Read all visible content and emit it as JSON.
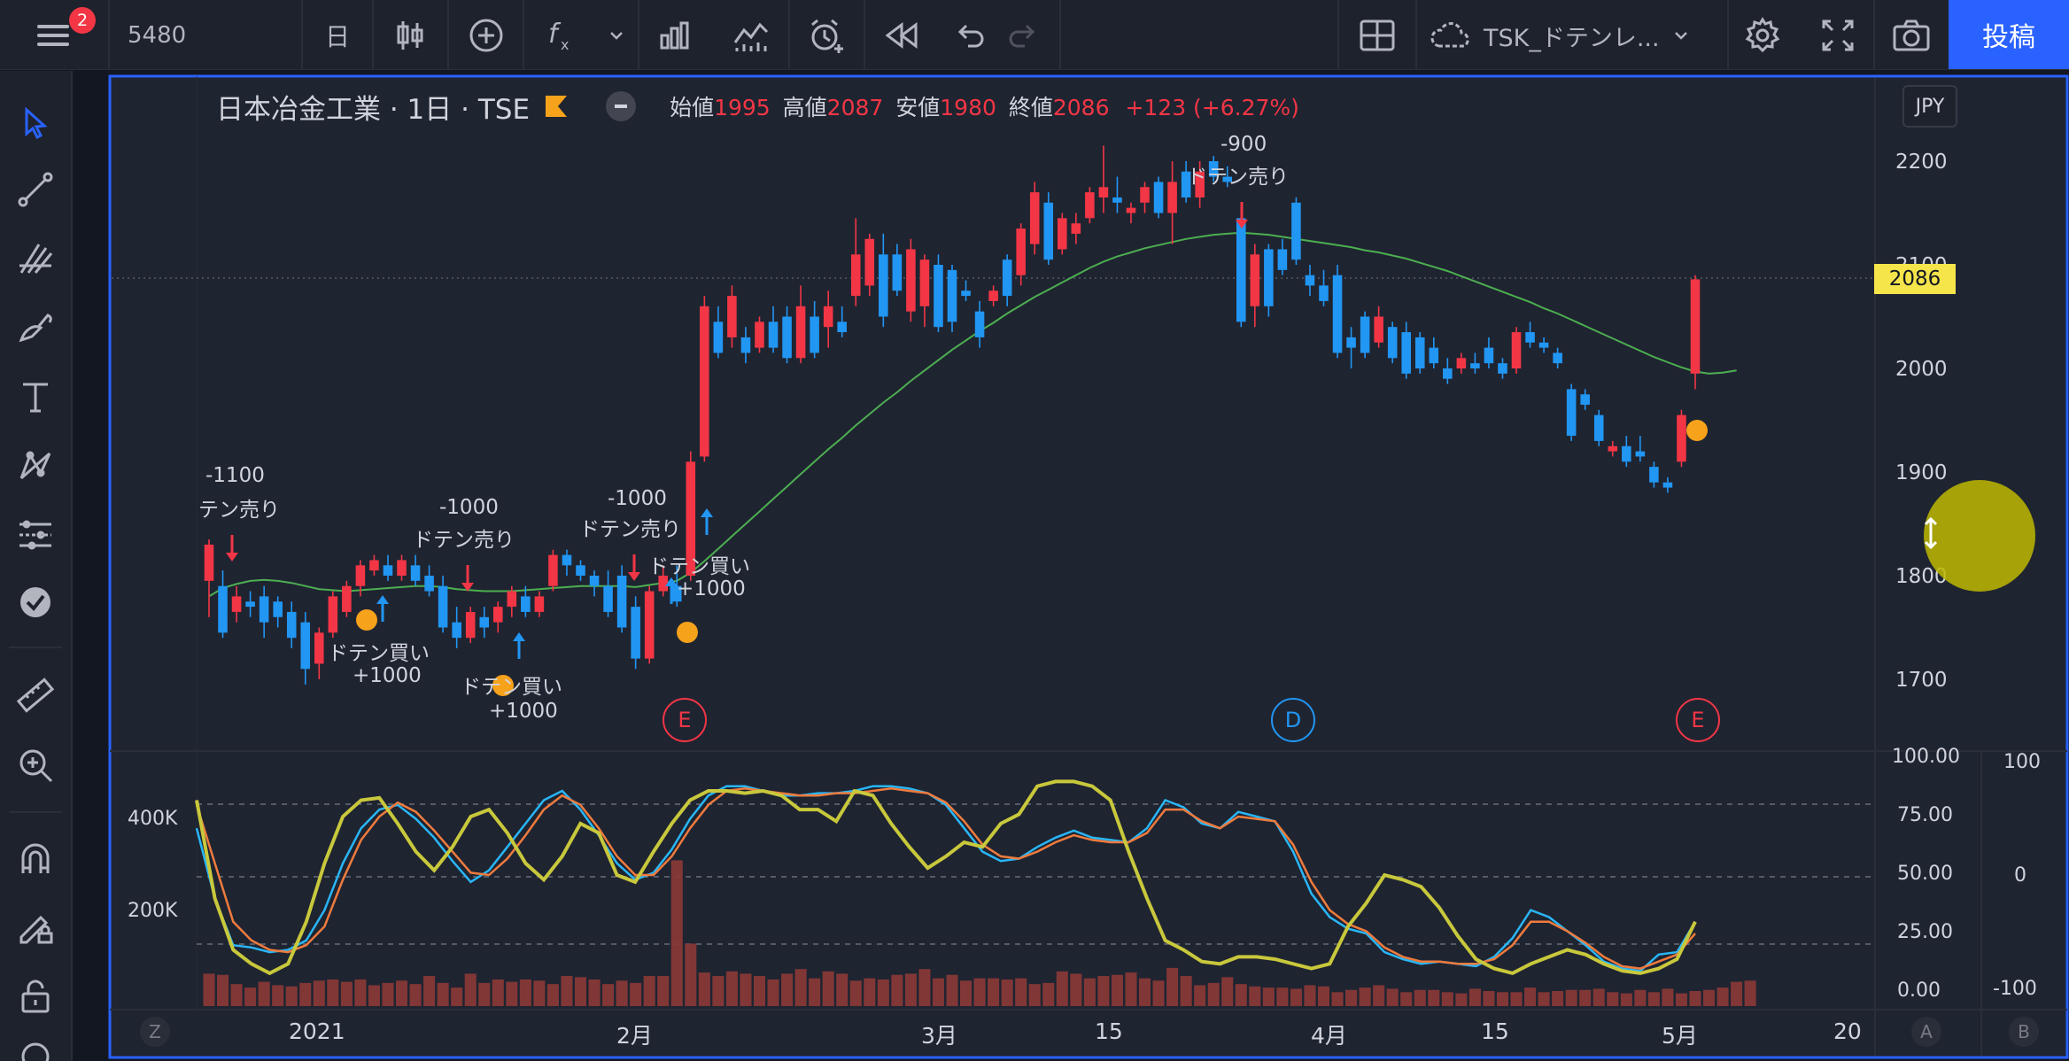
{
  "toolbar": {
    "menu_badge": "2",
    "symbol": "5480",
    "interval": "日",
    "indicator_label": "TSK_ドテンレ...",
    "publish_label": "投稿"
  },
  "legend": {
    "title": "日本冶金工業 · 1日 · TSE",
    "open_label": "始値",
    "open": "1995",
    "high_label": "高値",
    "high": "2087",
    "low_label": "安値",
    "low": "1980",
    "close_label": "終値",
    "close": "2086",
    "change": "+123 (+6.27%)"
  },
  "currency": "JPY",
  "last_price": "2086",
  "price_axis": {
    "ticks": [
      {
        "value": 2200,
        "label": "2200"
      },
      {
        "value": 2100,
        "label": "2100"
      },
      {
        "value": 2000,
        "label": "2000"
      },
      {
        "value": 1900,
        "label": "1900"
      },
      {
        "value": 1800,
        "label": "1800"
      },
      {
        "value": 1700,
        "label": "1700"
      }
    ]
  },
  "osc_axis": {
    "ticks": [
      "100.00",
      "75.00",
      "50.00",
      "25.00",
      "0.00"
    ],
    "right_ticks": [
      "100",
      "0",
      "-100"
    ],
    "volume_ticks": [
      "400K",
      "200K"
    ]
  },
  "time_axis": [
    "2021",
    "2月",
    "3月",
    "15",
    "4月",
    "15",
    "5月",
    "20"
  ],
  "bottom_buttons": {
    "left": "Z",
    "a": "A",
    "b": "B"
  },
  "event_markers": [
    "E",
    "D",
    "E"
  ],
  "signals": [
    {
      "text": "-1100"
    },
    {
      "text": "テン売り"
    },
    {
      "text": "-1000"
    },
    {
      "text": "ドテン売り"
    },
    {
      "text": "-1000"
    },
    {
      "text": "ドテン売り"
    },
    {
      "text": "-900"
    },
    {
      "text": "ドテン売り"
    },
    {
      "text": "ドテン買い"
    },
    {
      "text": "+1000"
    },
    {
      "text": "ドテン買い"
    },
    {
      "text": "+1000"
    },
    {
      "text": "ドテン買い"
    },
    {
      "text": "+1000"
    }
  ],
  "chart_data": {
    "type": "candlestick",
    "currency": "JPY",
    "ylim": [
      1660,
      2240
    ],
    "candles": [
      {
        "o": 1795,
        "h": 1835,
        "l": 1760,
        "c": 1830
      },
      {
        "o": 1790,
        "h": 1805,
        "l": 1740,
        "c": 1745
      },
      {
        "o": 1765,
        "h": 1790,
        "l": 1755,
        "c": 1780
      },
      {
        "o": 1775,
        "h": 1785,
        "l": 1760,
        "c": 1770
      },
      {
        "o": 1780,
        "h": 1790,
        "l": 1740,
        "c": 1755
      },
      {
        "o": 1775,
        "h": 1780,
        "l": 1750,
        "c": 1760
      },
      {
        "o": 1765,
        "h": 1775,
        "l": 1730,
        "c": 1740
      },
      {
        "o": 1755,
        "h": 1765,
        "l": 1695,
        "c": 1710
      },
      {
        "o": 1715,
        "h": 1750,
        "l": 1700,
        "c": 1745
      },
      {
        "o": 1745,
        "h": 1785,
        "l": 1740,
        "c": 1780
      },
      {
        "o": 1765,
        "h": 1795,
        "l": 1760,
        "c": 1790
      },
      {
        "o": 1790,
        "h": 1815,
        "l": 1780,
        "c": 1810
      },
      {
        "o": 1805,
        "h": 1820,
        "l": 1800,
        "c": 1815
      },
      {
        "o": 1810,
        "h": 1820,
        "l": 1795,
        "c": 1800
      },
      {
        "o": 1800,
        "h": 1820,
        "l": 1795,
        "c": 1815
      },
      {
        "o": 1810,
        "h": 1820,
        "l": 1790,
        "c": 1795
      },
      {
        "o": 1800,
        "h": 1810,
        "l": 1780,
        "c": 1785
      },
      {
        "o": 1790,
        "h": 1800,
        "l": 1745,
        "c": 1750
      },
      {
        "o": 1755,
        "h": 1770,
        "l": 1730,
        "c": 1740
      },
      {
        "o": 1740,
        "h": 1770,
        "l": 1735,
        "c": 1765
      },
      {
        "o": 1760,
        "h": 1770,
        "l": 1740,
        "c": 1750
      },
      {
        "o": 1755,
        "h": 1775,
        "l": 1745,
        "c": 1770
      },
      {
        "o": 1770,
        "h": 1790,
        "l": 1760,
        "c": 1785
      },
      {
        "o": 1780,
        "h": 1790,
        "l": 1760,
        "c": 1765
      },
      {
        "o": 1765,
        "h": 1785,
        "l": 1760,
        "c": 1780
      },
      {
        "o": 1790,
        "h": 1825,
        "l": 1785,
        "c": 1820
      },
      {
        "o": 1820,
        "h": 1825,
        "l": 1800,
        "c": 1810
      },
      {
        "o": 1810,
        "h": 1815,
        "l": 1795,
        "c": 1800
      },
      {
        "o": 1800,
        "h": 1805,
        "l": 1780,
        "c": 1790
      },
      {
        "o": 1790,
        "h": 1805,
        "l": 1760,
        "c": 1765
      },
      {
        "o": 1800,
        "h": 1810,
        "l": 1745,
        "c": 1750
      },
      {
        "o": 1770,
        "h": 1780,
        "l": 1710,
        "c": 1720
      },
      {
        "o": 1720,
        "h": 1790,
        "l": 1715,
        "c": 1785
      },
      {
        "o": 1785,
        "h": 1810,
        "l": 1780,
        "c": 1800
      },
      {
        "o": 1790,
        "h": 1810,
        "l": 1770,
        "c": 1775
      },
      {
        "o": 1800,
        "h": 1920,
        "l": 1795,
        "c": 1910
      },
      {
        "o": 1915,
        "h": 2070,
        "l": 1910,
        "c": 2060
      },
      {
        "o": 2045,
        "h": 2060,
        "l": 2010,
        "c": 2015
      },
      {
        "o": 2030,
        "h": 2080,
        "l": 2020,
        "c": 2070
      },
      {
        "o": 2030,
        "h": 2040,
        "l": 2005,
        "c": 2015
      },
      {
        "o": 2020,
        "h": 2050,
        "l": 2015,
        "c": 2045
      },
      {
        "o": 2045,
        "h": 2060,
        "l": 2015,
        "c": 2020
      },
      {
        "o": 2050,
        "h": 2060,
        "l": 2005,
        "c": 2010
      },
      {
        "o": 2010,
        "h": 2080,
        "l": 2005,
        "c": 2060
      },
      {
        "o": 2050,
        "h": 2065,
        "l": 2010,
        "c": 2015
      },
      {
        "o": 2040,
        "h": 2075,
        "l": 2020,
        "c": 2060
      },
      {
        "o": 2045,
        "h": 2060,
        "l": 2030,
        "c": 2035
      },
      {
        "o": 2070,
        "h": 2145,
        "l": 2060,
        "c": 2110
      },
      {
        "o": 2080,
        "h": 2130,
        "l": 2070,
        "c": 2125
      },
      {
        "o": 2110,
        "h": 2130,
        "l": 2040,
        "c": 2050
      },
      {
        "o": 2110,
        "h": 2120,
        "l": 2070,
        "c": 2075
      },
      {
        "o": 2055,
        "h": 2125,
        "l": 2045,
        "c": 2115
      },
      {
        "o": 2060,
        "h": 2110,
        "l": 2040,
        "c": 2105
      },
      {
        "o": 2100,
        "h": 2110,
        "l": 2035,
        "c": 2040
      },
      {
        "o": 2095,
        "h": 2100,
        "l": 2035,
        "c": 2045
      },
      {
        "o": 2075,
        "h": 2085,
        "l": 2065,
        "c": 2070
      },
      {
        "o": 2055,
        "h": 2065,
        "l": 2020,
        "c": 2030
      },
      {
        "o": 2065,
        "h": 2080,
        "l": 2060,
        "c": 2075
      },
      {
        "o": 2105,
        "h": 2110,
        "l": 2060,
        "c": 2070
      },
      {
        "o": 2090,
        "h": 2140,
        "l": 2080,
        "c": 2135
      },
      {
        "o": 2120,
        "h": 2180,
        "l": 2110,
        "c": 2170
      },
      {
        "o": 2160,
        "h": 2170,
        "l": 2100,
        "c": 2105
      },
      {
        "o": 2115,
        "h": 2150,
        "l": 2110,
        "c": 2145
      },
      {
        "o": 2130,
        "h": 2150,
        "l": 2120,
        "c": 2140
      },
      {
        "o": 2145,
        "h": 2175,
        "l": 2140,
        "c": 2170
      },
      {
        "o": 2165,
        "h": 2215,
        "l": 2150,
        "c": 2175
      },
      {
        "o": 2165,
        "h": 2185,
        "l": 2150,
        "c": 2160
      },
      {
        "o": 2150,
        "h": 2160,
        "l": 2140,
        "c": 2155
      },
      {
        "o": 2160,
        "h": 2180,
        "l": 2150,
        "c": 2175
      },
      {
        "o": 2180,
        "h": 2185,
        "l": 2145,
        "c": 2150
      },
      {
        "o": 2150,
        "h": 2200,
        "l": 2120,
        "c": 2180
      },
      {
        "o": 2190,
        "h": 2200,
        "l": 2160,
        "c": 2165
      },
      {
        "o": 2165,
        "h": 2200,
        "l": 2155,
        "c": 2190
      },
      {
        "o": 2200,
        "h": 2205,
        "l": 2180,
        "c": 2185
      },
      {
        "o": 2185,
        "h": 2195,
        "l": 2175,
        "c": 2180
      },
      {
        "o": 2145,
        "h": 2150,
        "l": 2040,
        "c": 2045
      },
      {
        "o": 2060,
        "h": 2120,
        "l": 2040,
        "c": 2110
      },
      {
        "o": 2115,
        "h": 2120,
        "l": 2050,
        "c": 2060
      },
      {
        "o": 2115,
        "h": 2125,
        "l": 2090,
        "c": 2095
      },
      {
        "o": 2160,
        "h": 2165,
        "l": 2100,
        "c": 2105
      },
      {
        "o": 2090,
        "h": 2100,
        "l": 2070,
        "c": 2080
      },
      {
        "o": 2080,
        "h": 2095,
        "l": 2060,
        "c": 2065
      },
      {
        "o": 2090,
        "h": 2100,
        "l": 2010,
        "c": 2015
      },
      {
        "o": 2030,
        "h": 2040,
        "l": 2000,
        "c": 2020
      },
      {
        "o": 2050,
        "h": 2055,
        "l": 2010,
        "c": 2015
      },
      {
        "o": 2025,
        "h": 2060,
        "l": 2020,
        "c": 2050
      },
      {
        "o": 2040,
        "h": 2045,
        "l": 2005,
        "c": 2010
      },
      {
        "o": 2035,
        "h": 2045,
        "l": 1990,
        "c": 1995
      },
      {
        "o": 2030,
        "h": 2035,
        "l": 1995,
        "c": 2000
      },
      {
        "o": 2020,
        "h": 2030,
        "l": 2000,
        "c": 2005
      },
      {
        "o": 2000,
        "h": 2010,
        "l": 1985,
        "c": 1990
      },
      {
        "o": 2000,
        "h": 2015,
        "l": 1995,
        "c": 2010
      },
      {
        "o": 2005,
        "h": 2015,
        "l": 1995,
        "c": 2000
      },
      {
        "o": 2020,
        "h": 2030,
        "l": 2000,
        "c": 2005
      },
      {
        "o": 2005,
        "h": 2010,
        "l": 1990,
        "c": 1995
      },
      {
        "o": 2000,
        "h": 2040,
        "l": 1995,
        "c": 2035
      },
      {
        "o": 2035,
        "h": 2045,
        "l": 2020,
        "c": 2025
      },
      {
        "o": 2025,
        "h": 2030,
        "l": 2015,
        "c": 2020
      },
      {
        "o": 2015,
        "h": 2020,
        "l": 2000,
        "c": 2005
      },
      {
        "o": 1980,
        "h": 1985,
        "l": 1930,
        "c": 1935
      },
      {
        "o": 1975,
        "h": 1980,
        "l": 1960,
        "c": 1965
      },
      {
        "o": 1955,
        "h": 1960,
        "l": 1925,
        "c": 1930
      },
      {
        "o": 1920,
        "h": 1930,
        "l": 1915,
        "c": 1925
      },
      {
        "o": 1925,
        "h": 1935,
        "l": 1905,
        "c": 1910
      },
      {
        "o": 1920,
        "h": 1935,
        "l": 1910,
        "c": 1915
      },
      {
        "o": 1905,
        "h": 1910,
        "l": 1885,
        "c": 1890
      },
      {
        "o": 1890,
        "h": 1895,
        "l": 1880,
        "c": 1885
      },
      {
        "o": 1910,
        "h": 1960,
        "l": 1905,
        "c": 1955
      },
      {
        "o": 1995,
        "h": 2090,
        "l": 1980,
        "c": 2086
      }
    ],
    "ma": [
      1780,
      1788,
      1792,
      1795,
      1796,
      1795,
      1793,
      1790,
      1787,
      1786,
      1785,
      1786,
      1787,
      1788,
      1789,
      1790,
      1790,
      1789,
      1787,
      1786,
      1785,
      1785,
      1785,
      1786,
      1787,
      1788,
      1789,
      1790,
      1790,
      1790,
      1790,
      1789,
      1791,
      1793,
      1795,
      1803,
      1814,
      1826,
      1838,
      1850,
      1862,
      1874,
      1886,
      1898,
      1910,
      1922,
      1933,
      1945,
      1956,
      1967,
      1977,
      1988,
      1998,
      2008,
      2018,
      2027,
      2036,
      2044,
      2053,
      2061,
      2069,
      2076,
      2083,
      2090,
      2097,
      2103,
      2108,
      2112,
      2116,
      2119,
      2122,
      2125,
      2127,
      2129,
      2130,
      2131,
      2130,
      2129,
      2127,
      2125,
      2123,
      2121,
      2119,
      2117,
      2114,
      2112,
      2109,
      2106,
      2102,
      2098,
      2094,
      2089,
      2084,
      2079,
      2074,
      2069,
      2064,
      2058,
      2053,
      2047,
      2041,
      2035,
      2029,
      2023,
      2017,
      2011,
      2006,
      2001,
      1997,
      1995,
      1996,
      1998
    ],
    "volume": [
      140,
      135,
      95,
      80,
      105,
      90,
      85,
      100,
      110,
      115,
      105,
      115,
      90,
      100,
      110,
      95,
      130,
      100,
      80,
      140,
      100,
      115,
      105,
      115,
      110,
      95,
      130,
      125,
      115,
      95,
      110,
      100,
      130,
      130,
      630,
      270,
      145,
      130,
      150,
      140,
      130,
      115,
      140,
      160,
      120,
      150,
      140,
      110,
      120,
      115,
      135,
      140,
      160,
      120,
      135,
      110,
      120,
      120,
      115,
      120,
      95,
      100,
      150,
      140,
      120,
      130,
      135,
      145,
      120,
      110,
      165,
      130,
      90,
      100,
      125,
      95,
      85,
      80,
      80,
      75,
      90,
      85,
      60,
      70,
      80,
      90,
      75,
      60,
      70,
      70,
      60,
      55,
      75,
      65,
      60,
      60,
      80,
      60,
      65,
      70,
      70,
      75,
      60,
      55,
      70,
      60,
      75,
      55,
      65,
      70,
      80,
      105,
      110
    ],
    "osc_series": [
      {
        "color": "#29b6f6",
        "values": [
          70,
          40,
          20,
          19,
          17,
          18,
          22,
          35,
          55,
          70,
          78,
          80,
          74,
          66,
          56,
          47,
          52,
          62,
          72,
          82,
          86,
          78,
          67,
          55,
          48,
          51,
          61,
          74,
          84,
          88,
          88,
          86,
          84,
          84,
          85,
          85,
          86,
          88,
          88,
          87,
          85,
          80,
          70,
          60,
          56,
          57,
          62,
          66,
          69,
          66,
          65,
          64,
          70,
          82,
          79,
          72,
          70,
          77,
          75,
          73,
          60,
          42,
          32,
          27,
          25,
          17,
          14,
          12,
          13,
          12,
          11,
          15,
          23,
          35,
          32,
          26,
          20,
          13,
          10,
          9,
          16,
          17,
          30
        ]
      },
      {
        "color": "#ef7b3d",
        "values": [
          80,
          55,
          30,
          22,
          18,
          17,
          20,
          28,
          48,
          65,
          75,
          81,
          77,
          69,
          60,
          51,
          50,
          57,
          67,
          78,
          84,
          80,
          70,
          58,
          50,
          50,
          58,
          70,
          80,
          86,
          87,
          86,
          85,
          84,
          84,
          85,
          85,
          86,
          87,
          86,
          85,
          81,
          73,
          63,
          58,
          57,
          60,
          64,
          67,
          65,
          64,
          64,
          68,
          78,
          78,
          73,
          70,
          75,
          74,
          73,
          63,
          47,
          35,
          29,
          26,
          19,
          15,
          13,
          13,
          12,
          12,
          14,
          20,
          30,
          30,
          26,
          21,
          15,
          11,
          10,
          13,
          16,
          25
        ]
      },
      {
        "color": "#c8c83c",
        "values": [
          82,
          40,
          18,
          12,
          8,
          12,
          30,
          55,
          75,
          82,
          83,
          72,
          60,
          52,
          62,
          75,
          78,
          68,
          55,
          48,
          58,
          72,
          68,
          50,
          47,
          60,
          72,
          82,
          86,
          86,
          85,
          86,
          84,
          78,
          78,
          73,
          86,
          84,
          72,
          62,
          53,
          58,
          64,
          62,
          72,
          76,
          88,
          90,
          90,
          88,
          82,
          60,
          40,
          22,
          18,
          13,
          12,
          15,
          15,
          14,
          12,
          10,
          12,
          28,
          38,
          50,
          48,
          45,
          36,
          24,
          14,
          10,
          8,
          12,
          15,
          18,
          16,
          12,
          9,
          8,
          10,
          14,
          30
        ]
      }
    ]
  }
}
